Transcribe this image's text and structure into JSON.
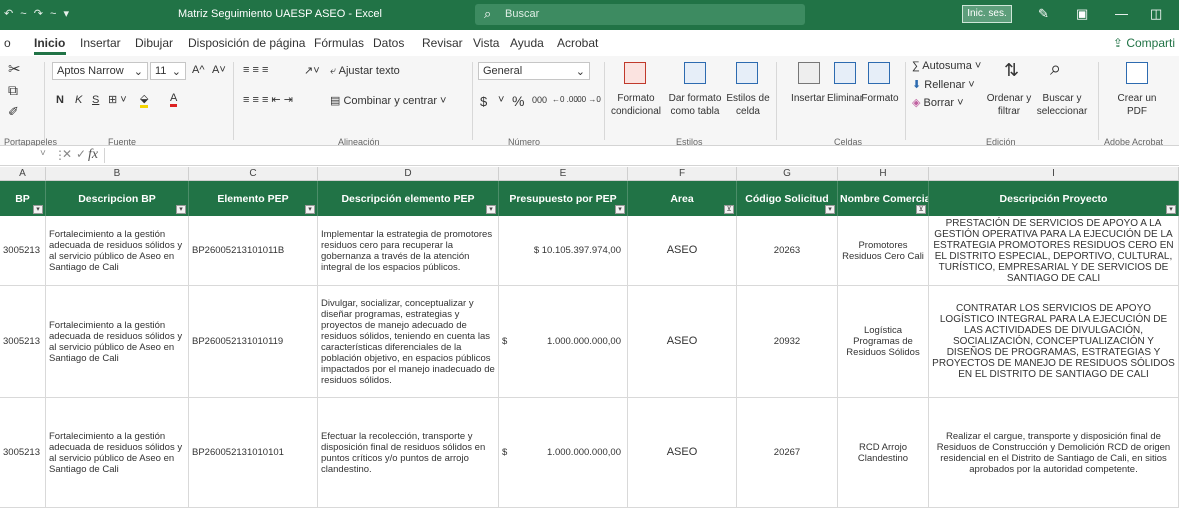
{
  "titlebar": {
    "quick_access": "↶ ~ ↷ ~ ▾",
    "doc_title": "Matriz Seguimiento UAESP ASEO - Excel",
    "search_placeholder": "Buscar",
    "signin": "Inic. ses."
  },
  "menu": {
    "items": [
      "o",
      "Inicio",
      "Insertar",
      "Dibujar",
      "Disposición de página",
      "Fórmulas",
      "Datos",
      "Revisar",
      "Vista",
      "Ayuda",
      "Acrobat"
    ],
    "share": "Comparti"
  },
  "ribbon": {
    "clipboard": {
      "label": "Portapapeles"
    },
    "font": {
      "name": "Aptos Narrow",
      "size": "11",
      "bold": "N",
      "italic": "K",
      "underline": "S",
      "grow": "A^",
      "shrink": "A˅",
      "label": "Fuente"
    },
    "alignment": {
      "wrap": "Ajustar texto",
      "merge": "Combinar y centrar",
      "label": "Alineación"
    },
    "number": {
      "format": "General",
      "currency": "$",
      "percent": "%",
      "thousands": "000",
      "inc_dec": "←0 .00",
      "dec_dec": ".00 →0",
      "label": "Número"
    },
    "styles": {
      "cond": "Formato condicional",
      "table": "Dar formato como tabla",
      "cell": "Estilos de celda",
      "label": "Estilos"
    },
    "cells": {
      "insert": "Insertar",
      "delete": "Eliminar",
      "format": "Formato",
      "label": "Celdas"
    },
    "editing": {
      "autosum": "Autosuma",
      "fill": "Rellenar",
      "clear": "Borrar",
      "sort": "Ordenar y filtrar",
      "find": "Buscar y seleccionar",
      "label": "Edición"
    },
    "acrobat": {
      "create": "Crear un PDF",
      "label": "Adobe Acrobat"
    }
  },
  "formulabar": {
    "fx": "fx"
  },
  "columns": [
    "A",
    "B",
    "C",
    "D",
    "E",
    "F",
    "G",
    "H",
    "I"
  ],
  "headers": [
    "BP",
    "Descripcion BP",
    "Elemento PEP",
    "Descripción elemento PEP",
    "Presupuesto por PEP",
    "Area",
    "Código Solicitud",
    "Nombre Comercial",
    "Descripción Proyecto"
  ],
  "rows": [
    {
      "bp": "3005213",
      "desc_bp": "Fortalecimiento a la gestión adecuada de residuos sólidos y al servicio público de Aseo en Santiago de Cali",
      "pep": "BP26005213101011B",
      "desc_pep": "Implementar la estrategia de promotores residuos cero para recuperar la gobernanza a través de la atención integral de los espacios públicos.",
      "budget": "$ 10.105.397.974,00",
      "area": "ASEO",
      "code": "20263",
      "comercial": "Promotores Residuos Cero Cali",
      "proyecto": "PRESTACIÓN DE SERVICIOS DE APOYO A LA GESTIÓN OPERATIVA PARA LA EJECUCIÓN DE LA ESTRATEGIA PROMOTORES RESIDUOS CERO EN EL DISTRITO ESPECIAL, DEPORTIVO, CULTURAL, TURÍSTICO, EMPRESARIAL Y DE SERVICIOS DE SANTIAGO DE CALI"
    },
    {
      "bp": "3005213",
      "desc_bp": "Fortalecimiento a la gestión adecuada de residuos sólidos y al servicio público de Aseo en Santiago de Cali",
      "pep": "BP260052131010119",
      "desc_pep": "Divulgar, socializar, conceptualizar y diseñar programas, estrategias y proyectos de manejo adecuado de residuos sólidos, teniendo en cuenta las características diferenciales de la población objetivo, en espacios públicos impactados por el manejo inadecuado de residuos sólidos.",
      "budget_symbol": "$",
      "budget": "1.000.000.000,00",
      "area": "ASEO",
      "code": "20932",
      "comercial": "Logística Programas de Residuos Sólidos",
      "proyecto": "CONTRATAR LOS SERVICIOS DE APOYO LOGÍSTICO INTEGRAL PARA LA EJECUCIÓN DE LAS ACTIVIDADES DE DIVULGACIÓN, SOCIALIZACIÓN, CONCEPTUALIZACIÓN Y DISEÑOS DE PROGRAMAS, ESTRATEGIAS Y PROYECTOS DE MANEJO DE RESIDUOS SÓLIDOS EN EL DISTRITO DE SANTIAGO DE CALI"
    },
    {
      "bp": "3005213",
      "desc_bp": "Fortalecimiento a la gestión adecuada de residuos sólidos y al servicio público de Aseo en Santiago de Cali",
      "pep": "BP260052131010101",
      "desc_pep": "Efectuar la recolección, transporte y disposición final de residuos sólidos en puntos críticos y/o puntos de arrojo clandestino.",
      "budget_symbol": "$",
      "budget": "1.000.000.000,00",
      "area": "ASEO",
      "code": "20267",
      "comercial": "RCD Arrojo Clandestino",
      "proyecto": "Realizar el cargue, transporte y disposición final de Residuos de Construcción y Demolición RCD de origen residencial en el Distrito de Santiago de Cali, en sitios aprobados por la autoridad competente."
    }
  ],
  "colors": {
    "excel_green": "#217346",
    "header_text": "#ffffff"
  }
}
